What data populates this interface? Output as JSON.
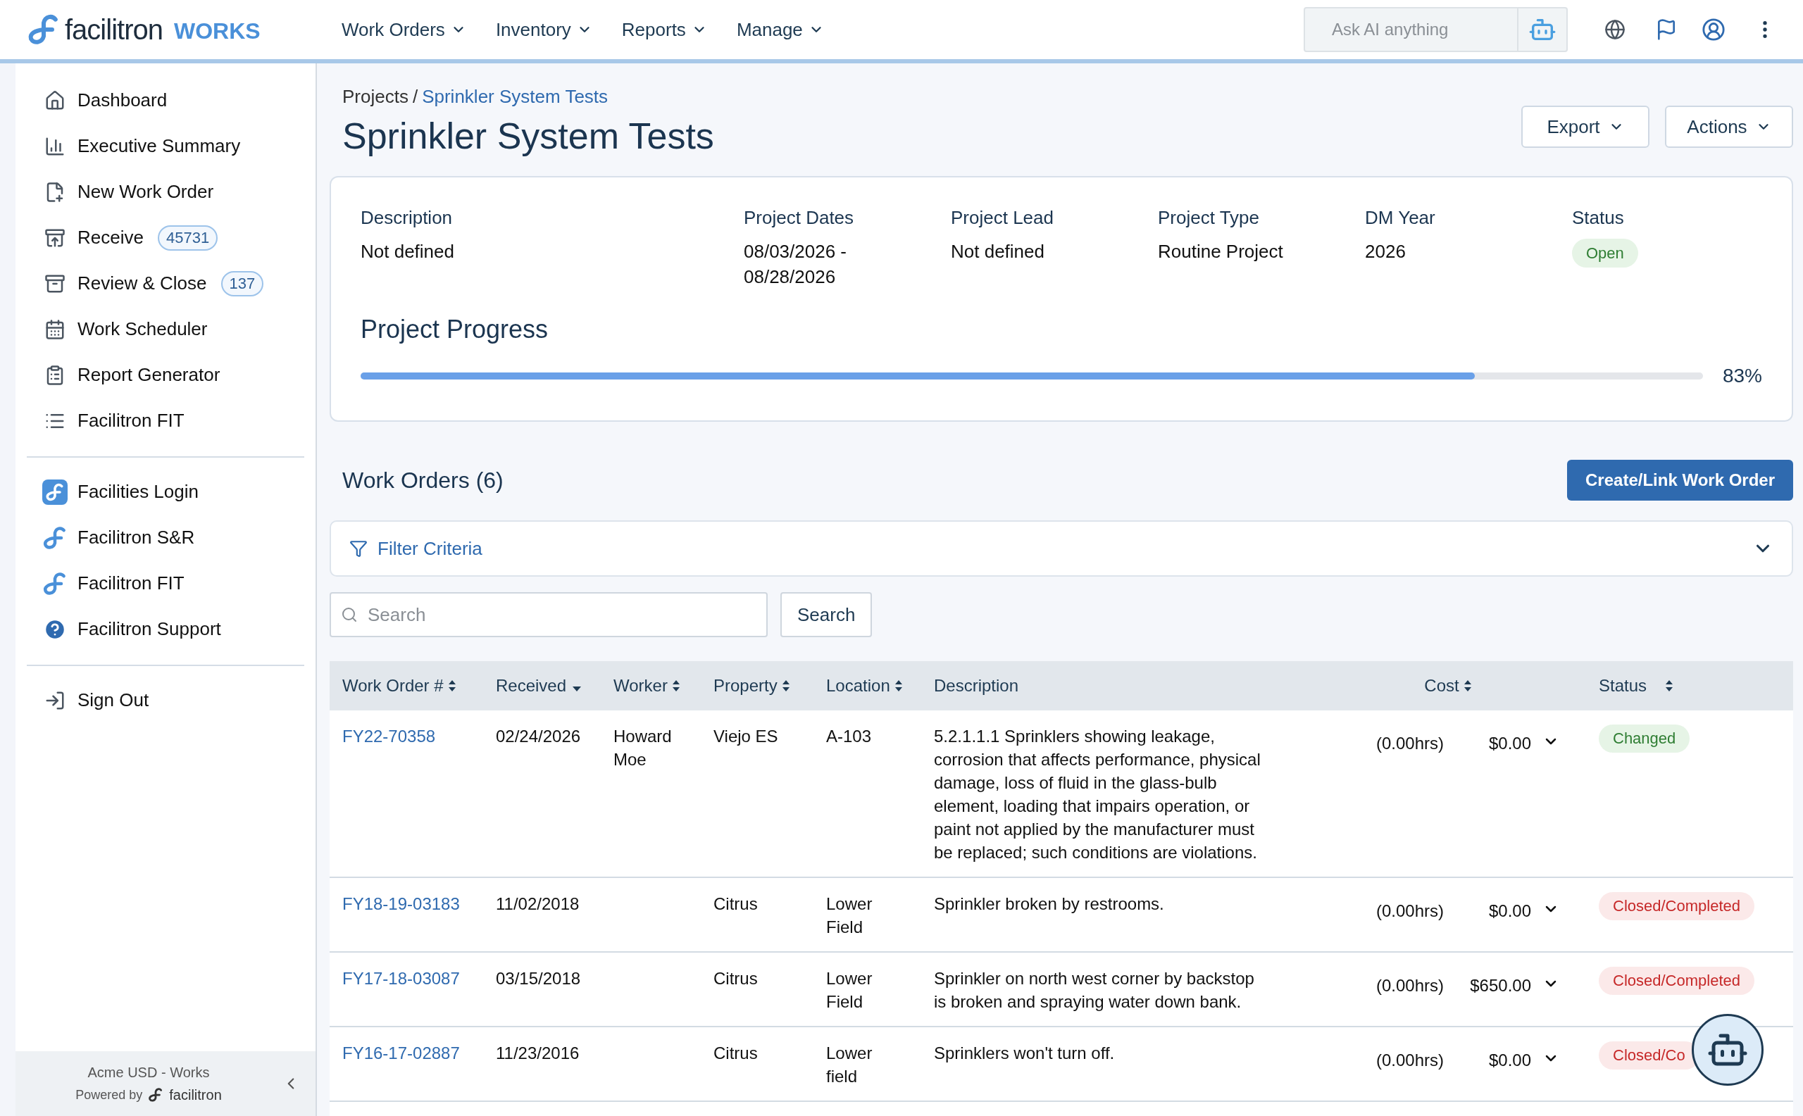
{
  "header": {
    "brand": "facilitron",
    "product": "WORKS",
    "nav": [
      "Work Orders",
      "Inventory",
      "Reports",
      "Manage"
    ],
    "ai_search": {
      "placeholder": "Ask AI anything"
    }
  },
  "sidebar": {
    "groups": [
      [
        {
          "label": "Dashboard"
        },
        {
          "label": "Executive Summary"
        },
        {
          "label": "New Work Order"
        },
        {
          "label": "Receive",
          "badge": "45731"
        },
        {
          "label": "Review & Close",
          "badge": "137"
        },
        {
          "label": "Work Scheduler"
        },
        {
          "label": "Report Generator"
        },
        {
          "label": "Facilitron FIT"
        }
      ],
      [
        {
          "label": "Facilities Login"
        },
        {
          "label": "Facilitron S&R"
        },
        {
          "label": "Facilitron FIT"
        },
        {
          "label": "Facilitron Support"
        }
      ],
      [
        {
          "label": "Sign Out"
        }
      ]
    ],
    "footer": {
      "org": "Acme USD - Works",
      "powered_by": "Powered by",
      "brand": "facilitron"
    }
  },
  "breadcrumb": {
    "items": [
      "Projects",
      "Sprinkler System Tests"
    ],
    "separator": "/"
  },
  "title": "Sprinkler System Tests",
  "actions": [
    "Export",
    "Actions"
  ],
  "details": [
    {
      "label": "Description",
      "value": "Not defined"
    },
    {
      "label": "Project Dates",
      "value": "08/03/2026 - 08/28/2026"
    },
    {
      "label": "Project Lead",
      "value": "Not defined"
    },
    {
      "label": "Project Type",
      "value": "Routine Project"
    },
    {
      "label": "DM Year",
      "value": "2026"
    }
  ],
  "status": {
    "label": "Status",
    "value": "Open"
  },
  "progress": {
    "title": "Project Progress",
    "level": 0.83,
    "reading": "83%"
  },
  "work_orders": {
    "title": "Work Orders (6)",
    "create_button": "Create/Link Work Order",
    "filter": "Filter Criteria",
    "search": {
      "placeholder": "Search",
      "button": "Search"
    },
    "columns": [
      {
        "label": "Work Order #",
        "sortable": true,
        "sorted": false
      },
      {
        "label": "Received",
        "sortable": true,
        "sorted": true
      },
      {
        "label": "Worker",
        "sortable": true,
        "sorted": false
      },
      {
        "label": "Property",
        "sortable": true,
        "sorted": false
      },
      {
        "label": "Location",
        "sortable": true,
        "sorted": false
      },
      {
        "label": "Description"
      },
      {
        "label": "Cost",
        "sortable": true,
        "sorted": false
      },
      {
        "label": "Status",
        "sortable": true,
        "sorted": false
      }
    ],
    "rows": [
      {
        "number": "FY22-70358",
        "received": "02/24/2026",
        "worker": "Howard Moe",
        "property": "Viejo ES",
        "location": "A-103",
        "description": "5.2.1.1.1 Sprinklers showing leakage, corrosion that affects performance, physical damage, loss of fluid in the glass-bulb element, loading that impairs operation, or paint not applied by the manufacturer must be replaced; such conditions are violations.",
        "hours": "(0.00hrs)",
        "cost": "$0.00",
        "status": "Changed",
        "kind": "changed"
      },
      {
        "number": "FY18-19-03183",
        "received": "11/02/2018",
        "property": "Citrus",
        "location": "Lower Field",
        "description": "Sprinkler broken by restrooms.",
        "hours": "(0.00hrs)",
        "cost": "$0.00",
        "status": "Closed/Completed",
        "kind": "closed"
      },
      {
        "number": "FY17-18-03087",
        "received": "03/15/2018",
        "property": "Citrus",
        "location": "Lower Field",
        "description": "Sprinkler on north west corner by backstop is broken and spraying water down bank.",
        "hours": "(0.00hrs)",
        "cost": "$650.00",
        "status": "Closed/Completed",
        "kind": "closed"
      },
      {
        "number": "FY16-17-02887",
        "received": "11/23/2016",
        "property": "Citrus",
        "location": "Lower field",
        "description": "Sprinklers won't turn off.",
        "hours": "(0.00hrs)",
        "cost": "$0.00",
        "status": "Closed/Co",
        "kind": "closed"
      }
    ]
  }
}
